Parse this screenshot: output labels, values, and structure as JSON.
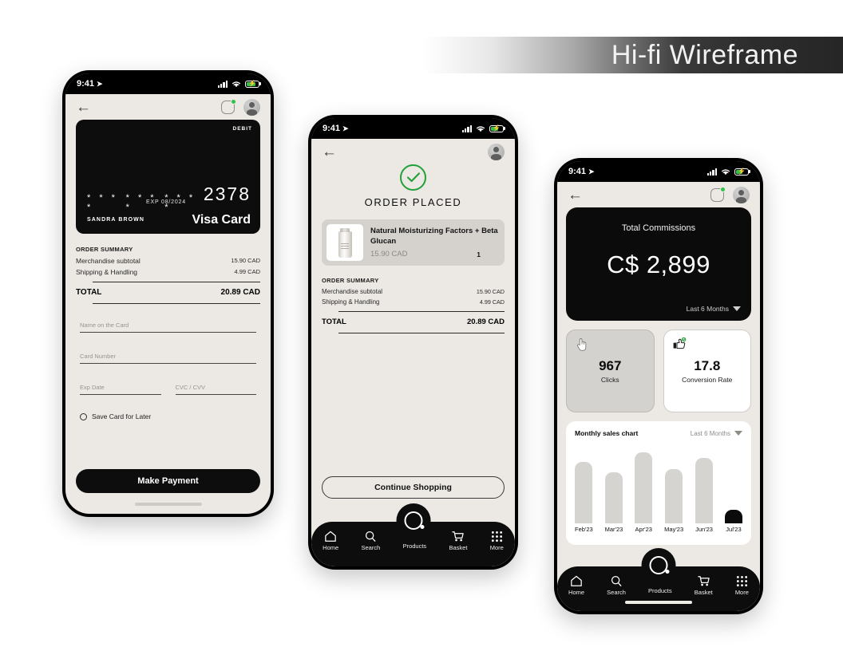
{
  "banner": {
    "title": "Hi-fi  Wireframe"
  },
  "status_bar": {
    "time": "9:41",
    "location_icon": "location-arrow-icon",
    "signal_icon": "cellular-bars-icon",
    "wifi_icon": "wifi-icon",
    "battery_icon": "battery-charging-icon"
  },
  "phone1": {
    "name": "payment-screen",
    "appbar": {
      "back_icon": "back-arrow-icon",
      "square_badge_icon": "notification-square-icon",
      "avatar_icon": "user-avatar-icon"
    },
    "card": {
      "type_label": "DEBIT",
      "masked_groups": [
        "* * * *",
        "* * * *",
        "* * * *"
      ],
      "last_four": "2378",
      "expiry": "EXP 08/2024",
      "holder": "SANDRA BROWN",
      "brand": "Visa Card"
    },
    "summary": {
      "heading": "ORDER SUMMARY",
      "rows": [
        {
          "label": "Merchandise subtotal",
          "value": "15.90 CAD"
        },
        {
          "label": "Shipping & Handling",
          "value": "4.99 CAD"
        }
      ],
      "total_label": "TOTAL",
      "total_value": "20.89 CAD"
    },
    "form": {
      "name_placeholder": "Name on the Card",
      "number_placeholder": "Card Number",
      "exp_placeholder": "Exp Date",
      "cvc_placeholder": "CVC / CVV",
      "save_card_label": "Save Card for Later"
    },
    "cta": "Make Payment"
  },
  "phone2": {
    "name": "order-placed-screen",
    "appbar": {
      "back_icon": "back-arrow-icon",
      "avatar_icon": "user-avatar-icon"
    },
    "status_icon": "green-check-circle-icon",
    "headline": "ORDER PLACED",
    "product": {
      "thumb_icon": "product-tube-image",
      "title": "Natural Moisturizing Factors + Beta Glucan",
      "price": "15.90 CAD",
      "quantity": "1"
    },
    "summary": {
      "heading": "ORDER SUMMARY",
      "rows": [
        {
          "label": "Merchandise subtotal",
          "value": "15.90 CAD"
        },
        {
          "label": "Shipping & Handling",
          "value": "4.99 CAD"
        }
      ],
      "total_label": "TOTAL",
      "total_value": "20.89 CAD"
    },
    "cta": "Continue Shopping",
    "nav": {
      "items": [
        {
          "label": "Home",
          "icon": "home-icon"
        },
        {
          "label": "Search",
          "icon": "search-icon"
        },
        {
          "label": "Products",
          "icon": "products-logo-icon"
        },
        {
          "label": "Basket",
          "icon": "shopping-cart-icon"
        },
        {
          "label": "More",
          "icon": "grid-dots-icon"
        }
      ]
    }
  },
  "phone3": {
    "name": "dashboard-screen",
    "appbar": {
      "back_icon": "back-arrow-icon",
      "square_badge_icon": "notification-square-icon",
      "avatar_icon": "user-avatar-icon"
    },
    "commissions": {
      "title": "Total Commissions",
      "amount": "C$ 2,899",
      "period": "Last 6 Months",
      "caret_icon": "chevron-down-icon"
    },
    "stats": [
      {
        "value": "967",
        "label": "Clicks",
        "icon": "hand-pointer-icon"
      },
      {
        "value": "17.8",
        "label": "Conversion Rate",
        "icon": "thumbs-up-icon"
      }
    ],
    "chart_period": "Last 6 Months",
    "nav": {
      "items": [
        {
          "label": "Home",
          "icon": "home-icon"
        },
        {
          "label": "Search",
          "icon": "search-icon"
        },
        {
          "label": "Products",
          "icon": "products-logo-icon"
        },
        {
          "label": "Basket",
          "icon": "shopping-cart-icon"
        },
        {
          "label": "More",
          "icon": "grid-dots-icon"
        }
      ]
    }
  },
  "chart_data": {
    "type": "bar",
    "title": "Monthly sales chart",
    "categories": [
      "Feb'23",
      "Mar'23",
      "Apr'23",
      "May'23",
      "Jun'23",
      "Jul'23"
    ],
    "values": [
      82,
      68,
      95,
      72,
      87,
      18
    ],
    "colors": [
      "#d6d4d1",
      "#d6d4d1",
      "#d6d4d1",
      "#d6d4d1",
      "#d6d4d1",
      "#0b0b0b"
    ],
    "xlabel": "",
    "ylabel": "",
    "ylim": [
      0,
      100
    ],
    "grid": false,
    "legend": false
  }
}
